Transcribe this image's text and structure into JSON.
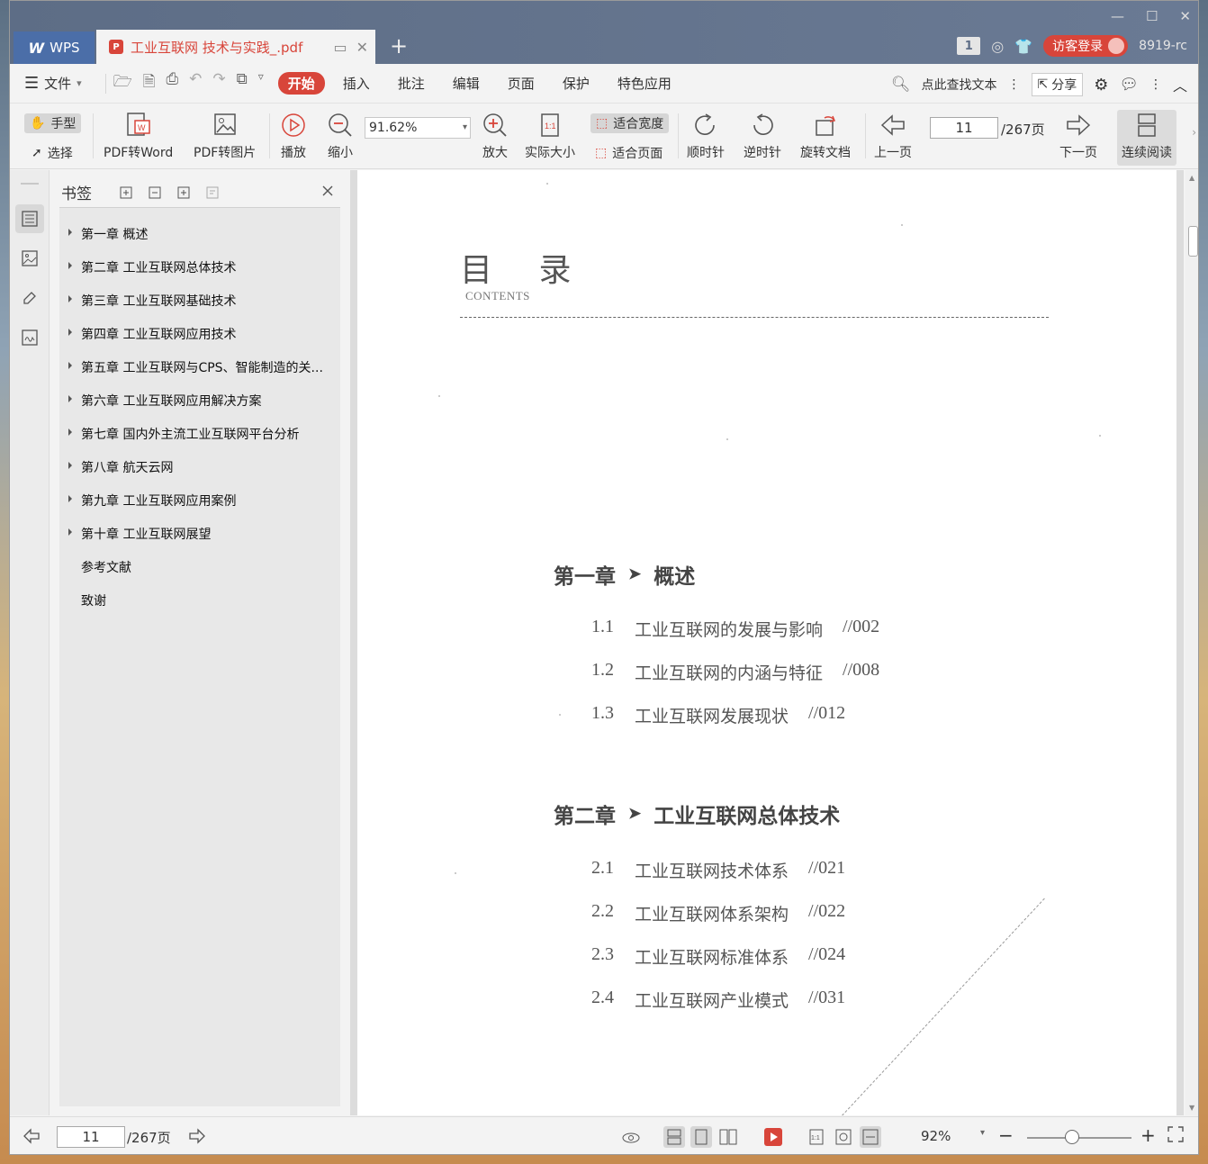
{
  "titlebar": {
    "app_tab": "WPS",
    "doc_tab": "工业互联网 技术与实践_.pdf",
    "window_badge": "1",
    "login_label": "访客登录",
    "user_code": "8919-rc"
  },
  "menubar": {
    "file_label": "文件",
    "tabs": [
      "开始",
      "插入",
      "批注",
      "编辑",
      "页面",
      "保护",
      "特色应用"
    ],
    "search_label": "点此查找文本",
    "share_label": "分享"
  },
  "toolbar": {
    "hand_label": "手型",
    "select_label": "选择",
    "pdf_to_word": "PDF转Word",
    "pdf_to_image": "PDF转图片",
    "play": "播放",
    "zoom_out": "缩小",
    "zoom_value": "91.62%",
    "zoom_in": "放大",
    "actual_size": "实际大小",
    "fit_width": "适合宽度",
    "fit_page": "适合页面",
    "rotate_cw": "顺时针",
    "rotate_ccw": "逆时针",
    "rotate_doc": "旋转文档",
    "prev_page": "上一页",
    "current_page": "11",
    "page_total": "/267页",
    "next_page": "下一页",
    "continuous_read": "连续阅读"
  },
  "bookmarks": {
    "title": "书签",
    "items": [
      {
        "label": "第一章 概述",
        "expandable": true
      },
      {
        "label": "第二章 工业互联网总体技术",
        "expandable": true
      },
      {
        "label": "第三章 工业互联网基础技术",
        "expandable": true
      },
      {
        "label": "第四章 工业互联网应用技术",
        "expandable": true
      },
      {
        "label": "第五章 工业互联网与CPS、智能制造的关...",
        "expandable": true
      },
      {
        "label": "第六章 工业互联网应用解决方案",
        "expandable": true
      },
      {
        "label": "第七章 国内外主流工业互联网平台分析",
        "expandable": true
      },
      {
        "label": "第八章 航天云网",
        "expandable": true
      },
      {
        "label": "第九章 工业互联网应用案例",
        "expandable": true
      },
      {
        "label": "第十章 工业互联网展望",
        "expandable": true
      },
      {
        "label": "参考文献",
        "expandable": false
      },
      {
        "label": "致谢",
        "expandable": false
      }
    ]
  },
  "document": {
    "toc_title": "目 录",
    "toc_subtitle": "CONTENTS",
    "chapters": [
      {
        "num": "第一章",
        "title": "概述",
        "sections": [
          {
            "num": "1.1",
            "title": "工业互联网的发展与影响",
            "page": "//002"
          },
          {
            "num": "1.2",
            "title": "工业互联网的内涵与特征",
            "page": "//008"
          },
          {
            "num": "1.3",
            "title": "工业互联网发展现状",
            "page": "//012"
          }
        ]
      },
      {
        "num": "第二章",
        "title": "工业互联网总体技术",
        "sections": [
          {
            "num": "2.1",
            "title": "工业互联网技术体系",
            "page": "//021"
          },
          {
            "num": "2.2",
            "title": "工业互联网体系架构",
            "page": "//022"
          },
          {
            "num": "2.3",
            "title": "工业互联网标准体系",
            "page": "//024"
          },
          {
            "num": "2.4",
            "title": "工业互联网产业模式",
            "page": "//031"
          }
        ]
      }
    ]
  },
  "statusbar": {
    "current_page": "11",
    "page_total": "/267页",
    "zoom_percent": "92%"
  },
  "colors": {
    "accent": "#d8453a",
    "titlebar": "#5d6d86",
    "chrome": "#f3f3f3"
  }
}
